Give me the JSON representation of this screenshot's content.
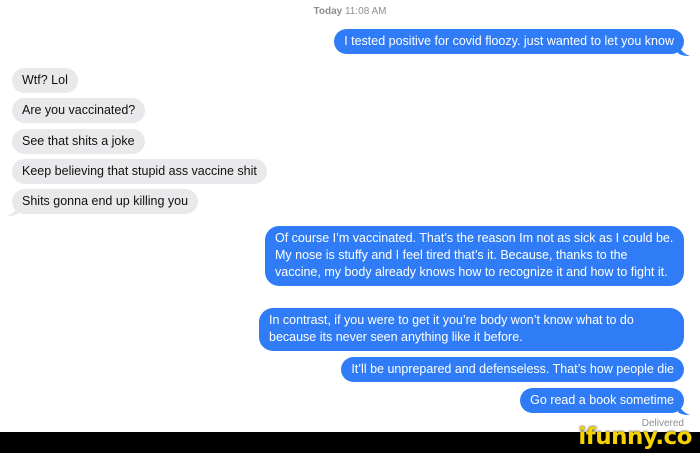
{
  "header": {
    "timestamp_day": "Today",
    "timestamp_time": "11:08 AM"
  },
  "messages": [
    {
      "dir": "out",
      "text": "I tested positive for covid floozy. just wanted to let you know"
    },
    {
      "dir": "in",
      "text": "Wtf? Lol"
    },
    {
      "dir": "in",
      "text": "Are you vaccinated?"
    },
    {
      "dir": "in",
      "text": "See that shits a joke"
    },
    {
      "dir": "in",
      "text": "Keep believing that stupid ass vaccine shit"
    },
    {
      "dir": "in",
      "text": "Shits gonna end up killing you"
    },
    {
      "dir": "out",
      "text": "Of course I’m vaccinated. That’s the reason Im not as sick as I could be. My nose is stuffy and I feel tired that’s it. Because, thanks to the vaccine, my body already knows how to recognize it and how to fight it."
    },
    {
      "dir": "out",
      "text": "In contrast, if you were to get it you’re body won’t know what to do because its never seen anything like it before."
    },
    {
      "dir": "out",
      "text": "It’ll be unprepared and defenseless. That’s how people die"
    },
    {
      "dir": "out",
      "text": "Go read a book sometime"
    }
  ],
  "status": {
    "delivered": "Delivered"
  },
  "watermark": {
    "text": "ifunny.co",
    "color": "#f5d300"
  },
  "colors": {
    "outgoing": "#2f7cf6",
    "incoming": "#e9e9eb"
  }
}
